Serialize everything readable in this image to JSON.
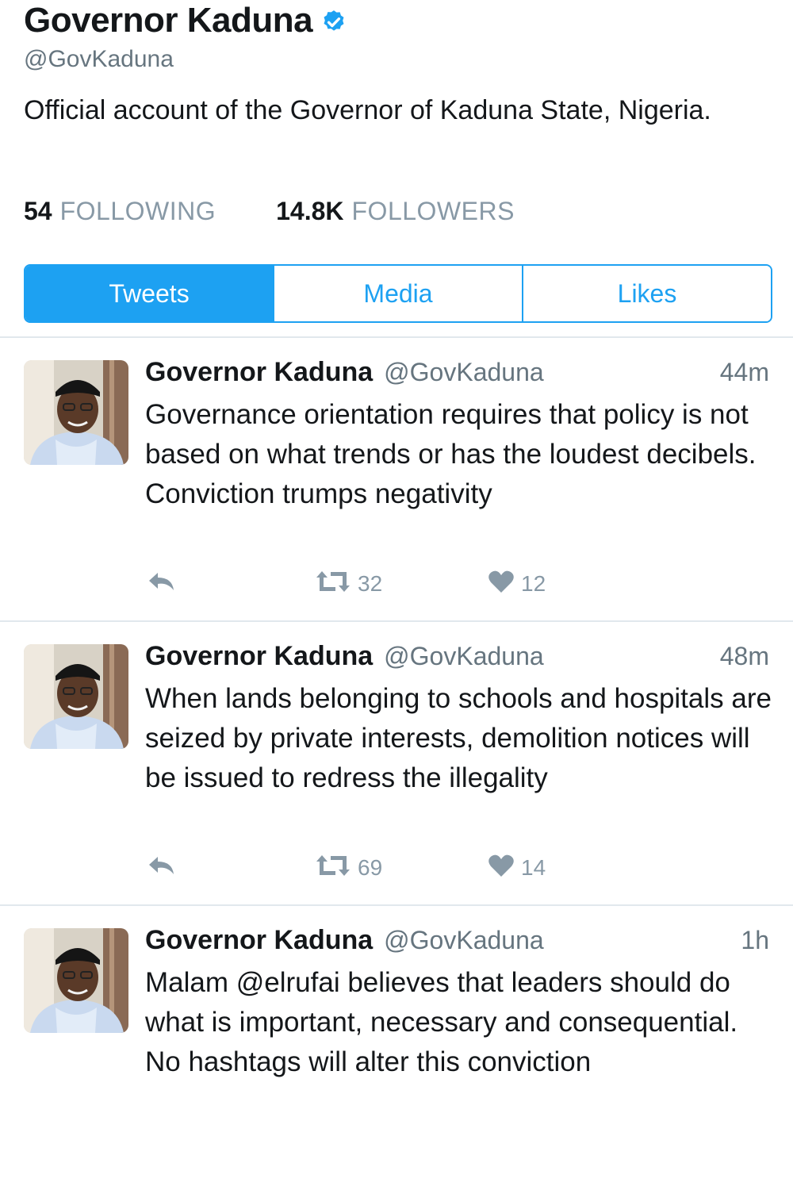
{
  "profile": {
    "name": "Governor Kaduna",
    "handle": "@GovKaduna",
    "bio": "Official account of the Governor of Kaduna State, Nigeria.",
    "verified_icon": "verified-badge-icon",
    "following_count": "54",
    "following_label": "FOLLOWING",
    "followers_count": "14.8K",
    "followers_label": "FOLLOWERS"
  },
  "tabs": [
    {
      "label": "Tweets",
      "active": true
    },
    {
      "label": "Media",
      "active": false
    },
    {
      "label": "Likes",
      "active": false
    }
  ],
  "tweets": [
    {
      "name": "Governor Kaduna",
      "handle": "@GovKaduna",
      "time": "44m",
      "text": "Governance orientation requires that policy is not based on what trends or has the loudest decibels. Conviction trumps negativity",
      "retweets": "32",
      "likes": "12"
    },
    {
      "name": "Governor Kaduna",
      "handle": "@GovKaduna",
      "time": "48m",
      "text": "When lands belonging to schools and hospitals are seized by private interests, demolition notices will be issued to redress the illegality",
      "retweets": "69",
      "likes": "14"
    },
    {
      "name": "Governor Kaduna",
      "handle": "@GovKaduna",
      "time": "1h",
      "text": "Malam @elrufai believes that leaders should do what is important, necessary and consequential. No hashtags will alter this conviction",
      "retweets": "",
      "likes": ""
    }
  ],
  "colors": {
    "accent": "#1da1f2",
    "text_primary": "#14171a",
    "text_secondary": "#66757f",
    "divider": "#e1e8ed"
  },
  "icons": {
    "reply": "reply-icon",
    "retweet": "retweet-icon",
    "like": "heart-icon"
  }
}
